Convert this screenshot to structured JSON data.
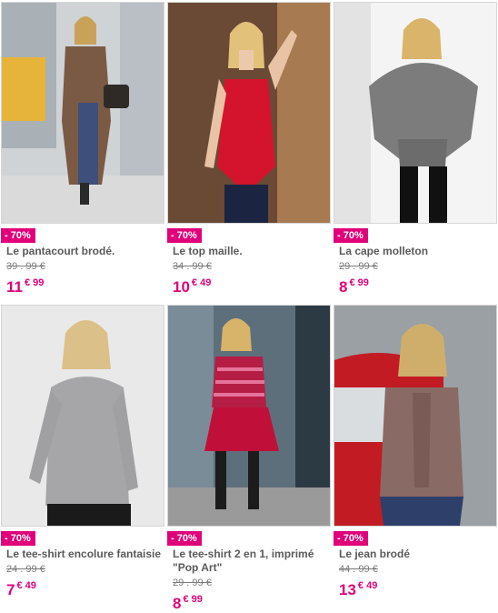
{
  "products": [
    {
      "discount": "- 70%",
      "title": "Le pantacourt brodé.",
      "old_price": "39 . 99 €",
      "price_int": "11",
      "price_cents": "€ 99"
    },
    {
      "discount": "- 70%",
      "title": "Le top maille.",
      "old_price": "34 . 99 €",
      "price_int": "10",
      "price_cents": "€ 49"
    },
    {
      "discount": "- 70%",
      "title": "La cape molleton",
      "old_price": "29 . 99 €",
      "price_int": "8",
      "price_cents": "€ 99"
    },
    {
      "discount": "- 70%",
      "title": "Le tee-shirt encolure fantaisie",
      "old_price": "24 . 99 €",
      "price_int": "7",
      "price_cents": "€ 49"
    },
    {
      "discount": "- 70%",
      "title": "Le tee-shirt 2 en 1, imprimé \"Pop Art\"",
      "old_price": "29 . 99 €",
      "price_int": "8",
      "price_cents": "€ 99"
    },
    {
      "discount": "- 70%",
      "title": "Le jean brodé",
      "old_price": "44 . 99 €",
      "price_int": "13",
      "price_cents": "€ 49"
    }
  ]
}
